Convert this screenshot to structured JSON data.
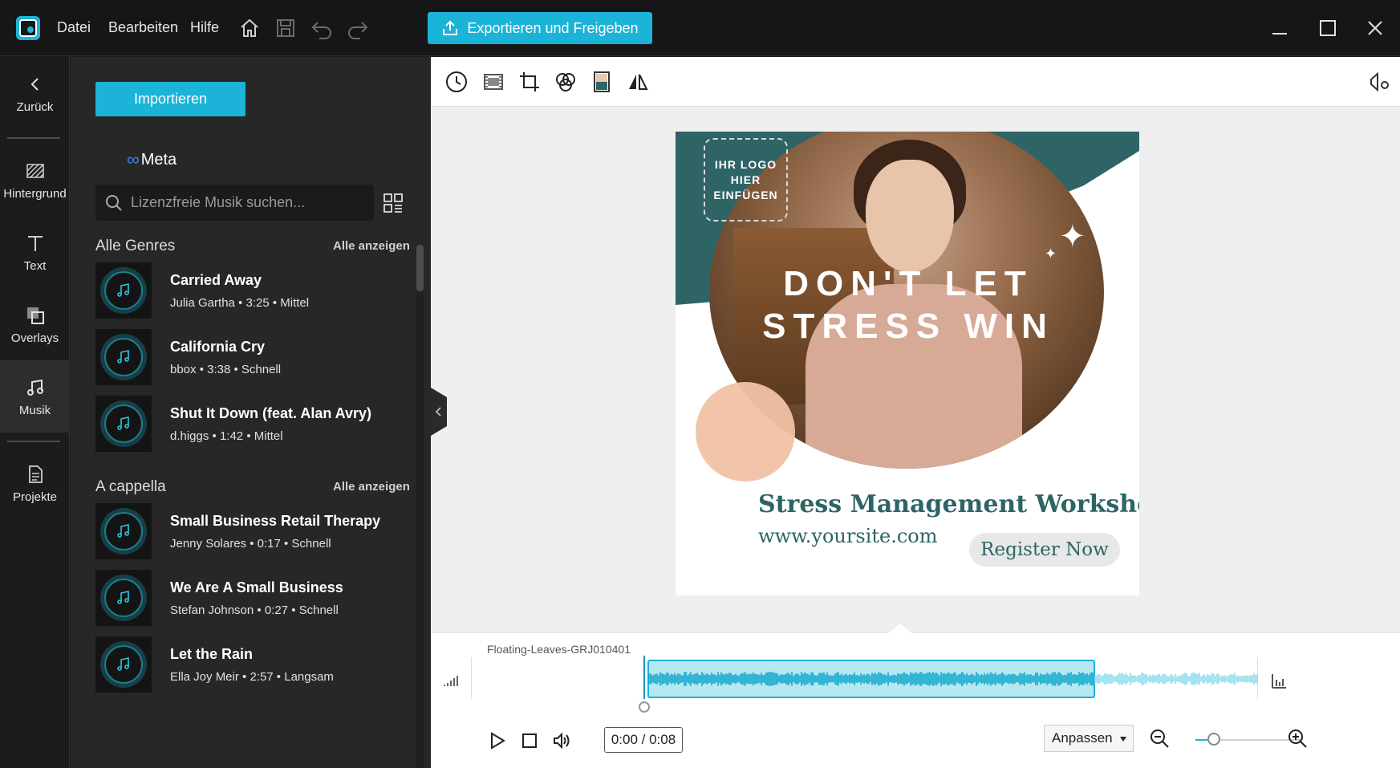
{
  "titlebar": {
    "menu": [
      "Datei",
      "Bearbeiten",
      "Hilfe"
    ],
    "export_label": "Exportieren und Freigeben",
    "accent": "#1bb3d8"
  },
  "leftnav": {
    "back": "Zurück",
    "items": [
      "Hintergrund",
      "Text",
      "Overlays",
      "Musik",
      "Projekte"
    ],
    "active": "Musik"
  },
  "panel": {
    "import_label": "Importieren",
    "provider": "Meta",
    "search_placeholder": "Lizenzfreie Musik suchen...",
    "sections": [
      {
        "title": "Alle Genres",
        "see_all": "Alle anzeigen",
        "tracks": [
          {
            "title": "Carried Away",
            "meta": "Julia Gartha • 3:25 • Mittel"
          },
          {
            "title": "California Cry",
            "meta": "bbox • 3:38 • Schnell"
          },
          {
            "title": "Shut It Down (feat. Alan Avry)",
            "meta": "d.higgs • 1:42 • Mittel"
          }
        ]
      },
      {
        "title": "A cappella",
        "see_all": "Alle anzeigen",
        "tracks": [
          {
            "title": "Small Business Retail Therapy",
            "meta": "Jenny Solares • 0:17 • Schnell"
          },
          {
            "title": "We Are A Small Business",
            "meta": "Stefan Johnson • 0:27 • Schnell"
          },
          {
            "title": "Let the Rain",
            "meta": "Ella Joy Meir • 2:57 • Langsam"
          }
        ]
      }
    ]
  },
  "canvas": {
    "logo_placeholder": "IHR LOGO HIER EINFÜGEN",
    "headline_1": "DON'T LET",
    "headline_2": "STRESS WIN",
    "workshop_title": "Stress Management Workshop",
    "url": "www.yoursite.com",
    "register_label": "Register Now",
    "brand_teal": "#2e6466",
    "peach": "#f1c2a5"
  },
  "timeline": {
    "clip_name": "Floating-Leaves-GRJ010401",
    "time": "0:00 / 0:08",
    "fit": "Anpassen",
    "selection_fraction": 0.73,
    "zoom_fraction": 0.17
  }
}
